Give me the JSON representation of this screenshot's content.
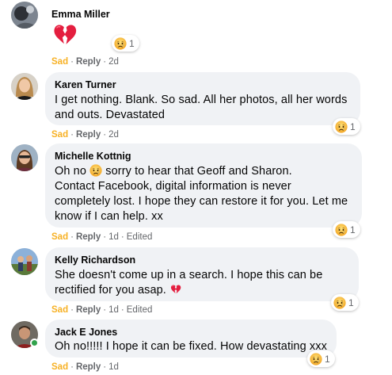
{
  "comments": [
    {
      "author": "Emma Miller",
      "text": "",
      "reaction_count": "1",
      "actions": {
        "reaction": "Sad",
        "reply": "Reply",
        "time": "2d",
        "edited": ""
      },
      "icon": "broken-heart-icon"
    },
    {
      "author": "Karen Turner",
      "text": "I get nothing. Blank. So sad. All her photos, all her words\nand outs. Devastated",
      "reaction_count": "1",
      "actions": {
        "reaction": "Sad",
        "reply": "Reply",
        "time": "2d",
        "edited": ""
      }
    },
    {
      "author": "Michelle Kottnig",
      "text_before_emoji": "Oh no ",
      "text_after_emoji": " sorry to hear that Geoff and Sharon.\nContact Facebook, digital information is never\ncompletely lost. I hope they can restore it for you. Let me\nknow if I can help. xx",
      "reaction_count": "1",
      "actions": {
        "reaction": "Sad",
        "reply": "Reply",
        "time": "1d",
        "edited": "Edited"
      }
    },
    {
      "author": "Kelly Richardson",
      "text_before_emoji": "She doesn't come up in a search. I hope this can be\nrectified for you asap. ",
      "reaction_count": "1",
      "actions": {
        "reaction": "Sad",
        "reply": "Reply",
        "time": "1d",
        "edited": "Edited"
      }
    },
    {
      "author": "Jack E Jones",
      "text": "Oh no!!!!! I hope it can be fixed. How devastating xxx",
      "reaction_count": "1",
      "actions": {
        "reaction": "Sad",
        "reply": "Reply",
        "time": "1d",
        "edited": ""
      }
    }
  ],
  "colors": {
    "bubble": "#f0f2f5",
    "sad_reaction": "#f7b125",
    "meta_text": "#65676b",
    "online": "#31a24c",
    "heart": "#e41e3f"
  }
}
